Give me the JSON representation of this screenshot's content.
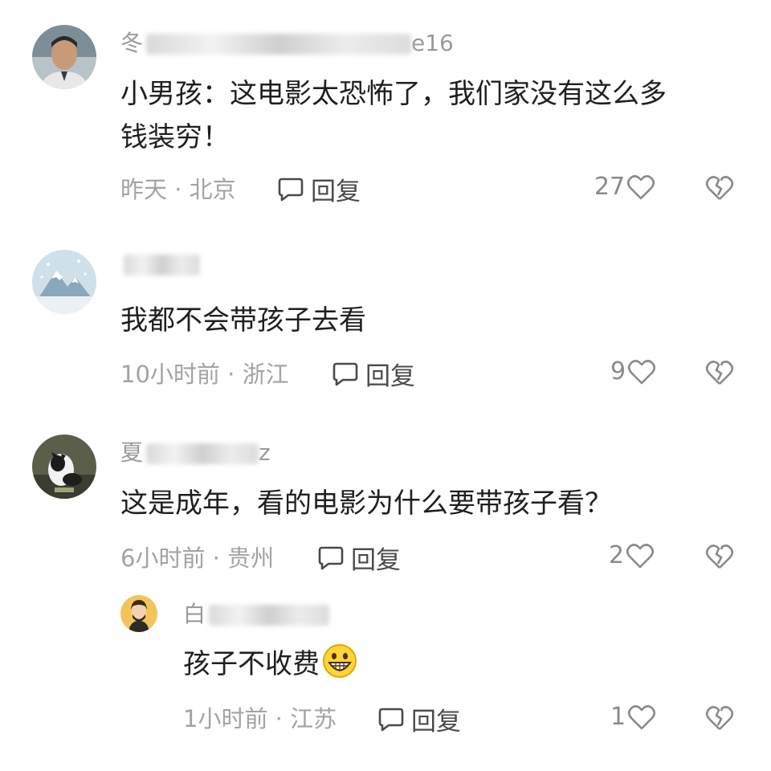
{
  "comments": [
    {
      "user_prefix": "冬",
      "user_suffix": "e16",
      "text_line1": "小男孩：这电影太恐怖了，我们家没有这么多",
      "text_line2": "钱装穷！",
      "time": "昨天",
      "location": "北京",
      "reply_label": "回复",
      "likes": "27"
    },
    {
      "user_prefix": "",
      "user_suffix": "",
      "text_line1": "我都不会带孩子去看",
      "time": "10小时前",
      "location": "浙江",
      "reply_label": "回复",
      "likes": "9"
    },
    {
      "user_prefix": "夏",
      "user_suffix": "z",
      "text_line1": "这是成年，看的电影为什么要带孩子看？",
      "time": "6小时前",
      "location": "贵州",
      "reply_label": "回复",
      "likes": "2"
    }
  ],
  "sub_reply": {
    "user_prefix": "白",
    "text": "孩子不收费",
    "emoji": "grinning-face-emoji",
    "time": "1小时前",
    "location": "江苏",
    "reply_label": "回复",
    "likes": "1"
  },
  "meta_separator": "·",
  "colors": {
    "text": "#1f1f1f",
    "muted": "#a3a3a3",
    "icon": "#8a8a8a"
  }
}
